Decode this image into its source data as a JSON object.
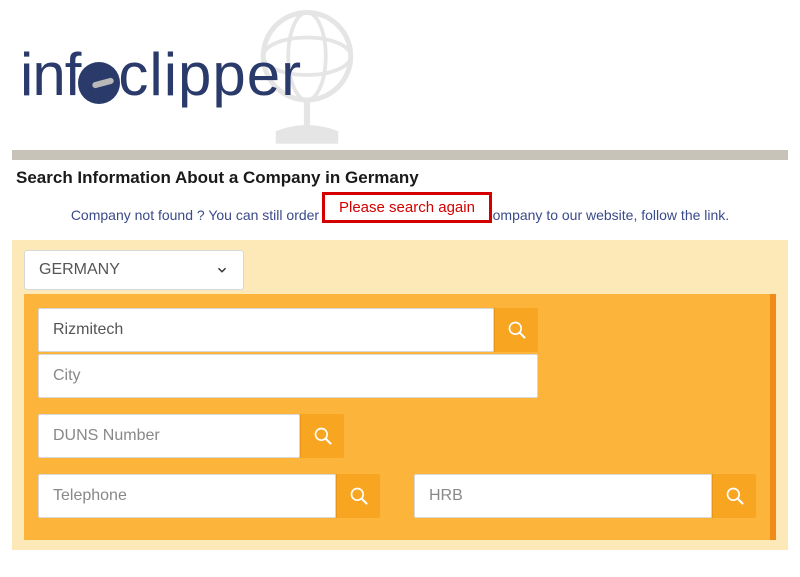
{
  "brand": {
    "prefix": "inf",
    "suffix": "clipper"
  },
  "heading": "Search Information About a Company in Germany",
  "alert": "Please search again",
  "subtext": "Company not found ? You can still order a report or ask to add this company to our website, follow the link.",
  "country": {
    "selected": "GERMANY"
  },
  "fields": {
    "company_value": "Rizmitech",
    "city_placeholder": "City",
    "duns_placeholder": "DUNS Number",
    "telephone_placeholder": "Telephone",
    "hrb_placeholder": "HRB"
  }
}
